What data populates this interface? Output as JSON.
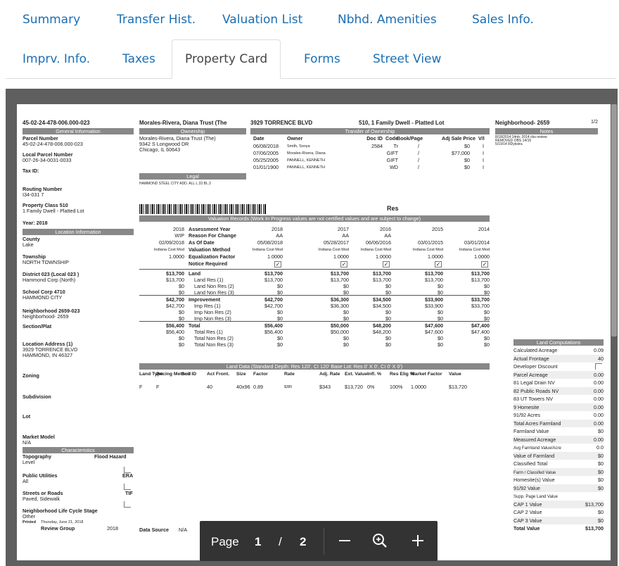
{
  "tabs": {
    "row1": [
      "Summary",
      "Transfer Hist.",
      "Valuation List",
      "Nbhd. Amenities",
      "Sales Info."
    ],
    "row2": [
      "Imprv. Info.",
      "Taxes",
      "Property Card",
      "Forms",
      "Street View"
    ],
    "active": "Property Card"
  },
  "card": {
    "parcel_id": "45-02-24-478-006.000-023",
    "owner_name": "Morales-Rivera, Diana Trust (The",
    "address_line": "3929 TORRENCE BLVD",
    "class_line": "510, 1 Family Dwell - Platted Lot",
    "neighborhood": "Neighborhood- 2659",
    "page_of": "1/2",
    "general_info_title": "General Information",
    "left_fields": [
      {
        "label": "Parcel Number",
        "value": "45-02-24-478-006.000-023"
      },
      {
        "label": "Local Parcel Number",
        "value": "007-26-34-0031-0033"
      },
      {
        "label": "Tax ID:",
        "value": ""
      },
      {
        "label": "Routing Number",
        "value": "I34-031 7"
      },
      {
        "label": "Property Class 510",
        "value": "1 Family Dwell - Platted Lot"
      },
      {
        "label": "Year: 2018",
        "value": ""
      }
    ],
    "location_title": "Location Information",
    "location_fields": [
      {
        "label": "County",
        "value": "Lake"
      },
      {
        "label": "Township",
        "value": "NORTH TOWNSHIP"
      },
      {
        "label": "District 023 (Local 023 )",
        "value": "Hammond Corp (North)"
      },
      {
        "label": "School Corp 4710",
        "value": "HAMMOND CITY"
      },
      {
        "label": "Neighborhood 2659-023",
        "value": "Neighborhood- 2659"
      },
      {
        "label": "Section/Plat",
        "value": ""
      },
      {
        "label": "Location Address (1)",
        "value": "3929 TORRENCE BLVD"
      },
      {
        "label": "",
        "value": "HAMMOND, IN 46327"
      },
      {
        "label": "Zoning",
        "value": ""
      },
      {
        "label": "Subdivision",
        "value": ""
      },
      {
        "label": "Lot",
        "value": ""
      },
      {
        "label": "Market Model",
        "value": "N/A"
      }
    ],
    "characteristics_title": "Characteristics",
    "characteristics": [
      {
        "label": "Topography",
        "right": "Flood Hazard",
        "value": "Level"
      },
      {
        "label": "Public Utilities",
        "right": "ERA",
        "value": "All"
      },
      {
        "label": "Streets or Roads",
        "right": "TIF",
        "value": "Paved, Sidewalk"
      },
      {
        "label": "Neighborhood Life Cycle Stage",
        "right": "",
        "value": "Other"
      }
    ],
    "printed": "Printed",
    "printed_date": "Thursday, June 21, 2018",
    "review_group": "Review Group",
    "review_year": "2018",
    "data_source": "Data Source",
    "data_source_value": "N/A",
    "ownership_title": "Ownership",
    "ownership_lines": [
      "Morales-Rivera, Diana Trust (The)",
      "9342 S Longwood DR",
      "Chicago, IL 60643"
    ],
    "legal_title": "Legal",
    "legal_text": "HAMMOND STEEL CITY ADD. ALL L.33 BL.3",
    "transfer_title": "Transfer of Ownership",
    "transfer_headers": [
      "Date",
      "Owner",
      "Doc ID",
      "Code",
      "Book/Page",
      "Adj Sale Price",
      "V/I"
    ],
    "transfers": [
      [
        "06/08/2018",
        "Smith, Sonya",
        "2584",
        "Tr",
        "/",
        "$0",
        "I"
      ],
      [
        "07/06/2005",
        "Morales-Rivera, Diana",
        "",
        "GIFT",
        "/",
        "$77,000",
        "I"
      ],
      [
        "05/25/2005",
        "PANNELL, KENNETH",
        "",
        "GIFT",
        "/",
        "$0",
        "I"
      ],
      [
        "01/01/1900",
        "PANNELL, KENNETH",
        "",
        "WD",
        "/",
        "$0",
        "I"
      ]
    ],
    "notes_title": "Notes",
    "notes": [
      "8/18/2014 14nb: 2014 cbs review",
      "REMOVED OBS 14/15",
      "5/19/14 RDykstra"
    ],
    "res_label": "Res",
    "valuation_title": "Valuation Records (Work In Progress values are not certified values and are subject to change)",
    "val_years": [
      "2018",
      "2017",
      "2016",
      "2015",
      "2014"
    ],
    "val_rows": [
      {
        "lead": "2018",
        "label": "Assessment Year",
        "vals": [
          "2018",
          "2017",
          "2016",
          "2015",
          "2014"
        ]
      },
      {
        "lead": "WIP",
        "label": "Reason For Change",
        "vals": [
          "AA",
          "AA",
          "AA",
          "",
          ""
        ]
      },
      {
        "lead": "02/09/2018",
        "label": "As Of Date",
        "vals": [
          "05/08/2018",
          "05/28/2017",
          "06/06/2016",
          "03/01/2015",
          "03/01/2014"
        ]
      },
      {
        "lead": "Indiana Cost Mod",
        "label": "Valuation Method",
        "vals": [
          "Indiana Cost Mod",
          "Indiana Cost Mod",
          "Indiana Cost Mod",
          "Indiana Cost Mod",
          "Indiana Cost Mod"
        ]
      },
      {
        "lead": "1.0000",
        "label": "Equalization Factor",
        "vals": [
          "1.0000",
          "1.0000",
          "1.0000",
          "1.0000",
          "1.0000"
        ]
      },
      {
        "lead": "",
        "label": "Notice Required",
        "vals": [
          "✓",
          "✓",
          "✓",
          "✓",
          "✓"
        ]
      },
      {
        "lead": "$13,700",
        "label": "Land",
        "vals": [
          "$13,700",
          "$13,700",
          "$13,700",
          "$13,700",
          "$13,700"
        ]
      },
      {
        "lead": "$13,700",
        "label": "Land Res (1)",
        "vals": [
          "$13,700",
          "$13,700",
          "$13,700",
          "$13,700",
          "$13,700"
        ]
      },
      {
        "lead": "$0",
        "label": "Land Non Res (2)",
        "vals": [
          "$0",
          "$0",
          "$0",
          "$0",
          "$0"
        ]
      },
      {
        "lead": "$0",
        "label": "Land Non Res (3)",
        "vals": [
          "$0",
          "$0",
          "$0",
          "$0",
          "$0"
        ]
      },
      {
        "lead": "$42,700",
        "label": "Improvement",
        "vals": [
          "$42,700",
          "$36,300",
          "$34,500",
          "$33,900",
          "$33,700"
        ]
      },
      {
        "lead": "$42,700",
        "label": "Imp Res (1)",
        "vals": [
          "$42,700",
          "$36,300",
          "$34,500",
          "$33,900",
          "$33,700"
        ]
      },
      {
        "lead": "$0",
        "label": "Imp Non Res (2)",
        "vals": [
          "$0",
          "$0",
          "$0",
          "$0",
          "$0"
        ]
      },
      {
        "lead": "$0",
        "label": "Imp Non Res (3)",
        "vals": [
          "$0",
          "$0",
          "$0",
          "$0",
          "$0"
        ]
      },
      {
        "lead": "$56,400",
        "label": "Total",
        "vals": [
          "$56,400",
          "$50,000",
          "$48,200",
          "$47,600",
          "$47,400"
        ]
      },
      {
        "lead": "$56,400",
        "label": "Total Res (1)",
        "vals": [
          "$56,400",
          "$50,000",
          "$48,200",
          "$47,600",
          "$47,400"
        ]
      },
      {
        "lead": "$0",
        "label": "Total Non Res (2)",
        "vals": [
          "$0",
          "$0",
          "$0",
          "$0",
          "$0"
        ]
      },
      {
        "lead": "$0",
        "label": "Total Non Res (3)",
        "vals": [
          "$0",
          "$0",
          "$0",
          "$0",
          "$0"
        ]
      }
    ],
    "land_data_title": "Land Data (Standard Depth: Res 120', CI 120'   Base Lot: Res 0' X 0', CI 0' X 0')",
    "land_headers": [
      "Land Type",
      "Pricing Method",
      "Soil ID",
      "Act Front.",
      "Size",
      "Factor",
      "Rate",
      "Adj. Rate",
      "Ext. Value",
      "Infl. %",
      "Res Elig %",
      "Market Factor",
      "Value"
    ],
    "land_row": [
      "F",
      "F",
      "",
      "40",
      "40x96",
      "0.89",
      "$385",
      "$343",
      "$13,720",
      "0%",
      "100%",
      "1.0000",
      "$13,720"
    ],
    "land_comp_title": "Land Computations",
    "land_comp": [
      [
        "Calculated Acreage",
        "0.09"
      ],
      [
        "Actual Frontage",
        "40"
      ],
      [
        "Developer Discount",
        ""
      ],
      [
        "Parcel Acreage",
        "0.00"
      ],
      [
        "81 Legal Drain NV",
        "0.00"
      ],
      [
        "82 Public Roads NV",
        "0.00"
      ],
      [
        "83 UT Towers NV",
        "0.00"
      ],
      [
        "9 Homesite",
        "0.00"
      ],
      [
        "91/92 Acres",
        "0.00"
      ],
      [
        "Total Acres Farmland",
        "0.00"
      ],
      [
        "Farmland Value",
        "$0"
      ],
      [
        "Measured Acreage",
        "0.00"
      ],
      [
        "Avg Farmland Value/Acre",
        "0.0"
      ],
      [
        "Value of Farmland",
        "$0"
      ],
      [
        "Classified Total",
        "$0"
      ],
      [
        "Farm / Classifed Value",
        "$0"
      ],
      [
        "Homesite(s) Value",
        "$0"
      ],
      [
        "91/92 Value",
        "$0"
      ],
      [
        "Supp. Page Land Value",
        ""
      ],
      [
        "CAP 1 Value",
        "$13,700"
      ],
      [
        "CAP 2 Value",
        "$0"
      ],
      [
        "CAP 3 Value",
        "$0"
      ],
      [
        "Total Value",
        "$13,700"
      ]
    ]
  },
  "toolbar": {
    "page_label": "Page",
    "current": "1",
    "slash": "/",
    "total": "2"
  }
}
